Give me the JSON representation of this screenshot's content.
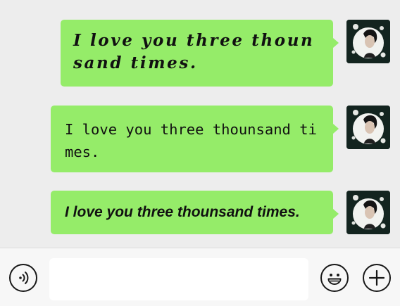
{
  "messages": [
    {
      "text": "I love you three thounsand times.",
      "style": "script"
    },
    {
      "text": "I love you three thounsand times.",
      "style": "typewriter"
    },
    {
      "text": "I love you three thounsand times.",
      "style": "bold-italic"
    }
  ],
  "colors": {
    "background": "#ededed",
    "bubble": "#95ec69",
    "input_bar": "#f7f7f7",
    "icon": "#181818"
  },
  "input_bar": {
    "voice_icon": "voice-icon",
    "message_input_value": "",
    "emoji_icon": "emoji-icon",
    "plus_icon": "plus-icon"
  }
}
